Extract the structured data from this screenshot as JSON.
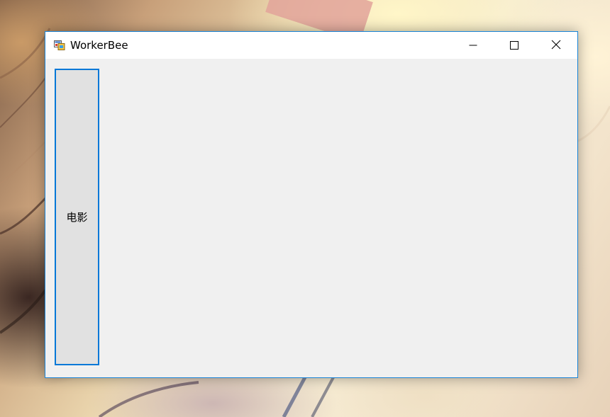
{
  "window": {
    "title": "WorkerBee",
    "icon": "winforms-app-icon"
  },
  "caption_buttons": {
    "minimize_icon": "minimize-icon",
    "maximize_icon": "maximize-icon",
    "close_icon": "close-icon"
  },
  "client": {
    "movie_button_label": "电影"
  },
  "colors": {
    "window_border": "#1883d7",
    "button_focus_border": "#0078d7",
    "client_background": "#f0f0f0",
    "button_background": "#e1e1e1"
  }
}
